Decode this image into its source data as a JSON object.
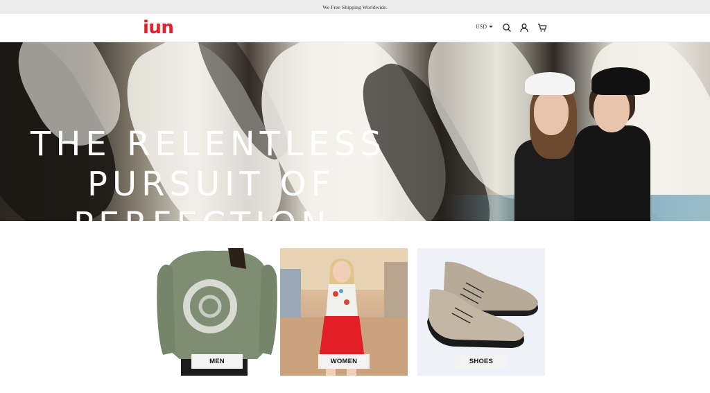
{
  "announcement": {
    "text": "We Free Shipping Worldwide."
  },
  "header": {
    "logo": "iun",
    "currency": "USD",
    "icons": [
      "search-icon",
      "account-icon",
      "cart-icon"
    ]
  },
  "hero": {
    "lines": [
      "THE RELENTLESS",
      "PURSUIT OF",
      "PERFECTION"
    ],
    "colors": {
      "text": "#ffffff"
    }
  },
  "categories": [
    {
      "label": "MEN"
    },
    {
      "label": "WOMEN"
    },
    {
      "label": "SHOES"
    }
  ],
  "colors": {
    "brand": "#e2202f",
    "announcement_bg": "#ececec",
    "label_bg": "#f3f3f3"
  }
}
